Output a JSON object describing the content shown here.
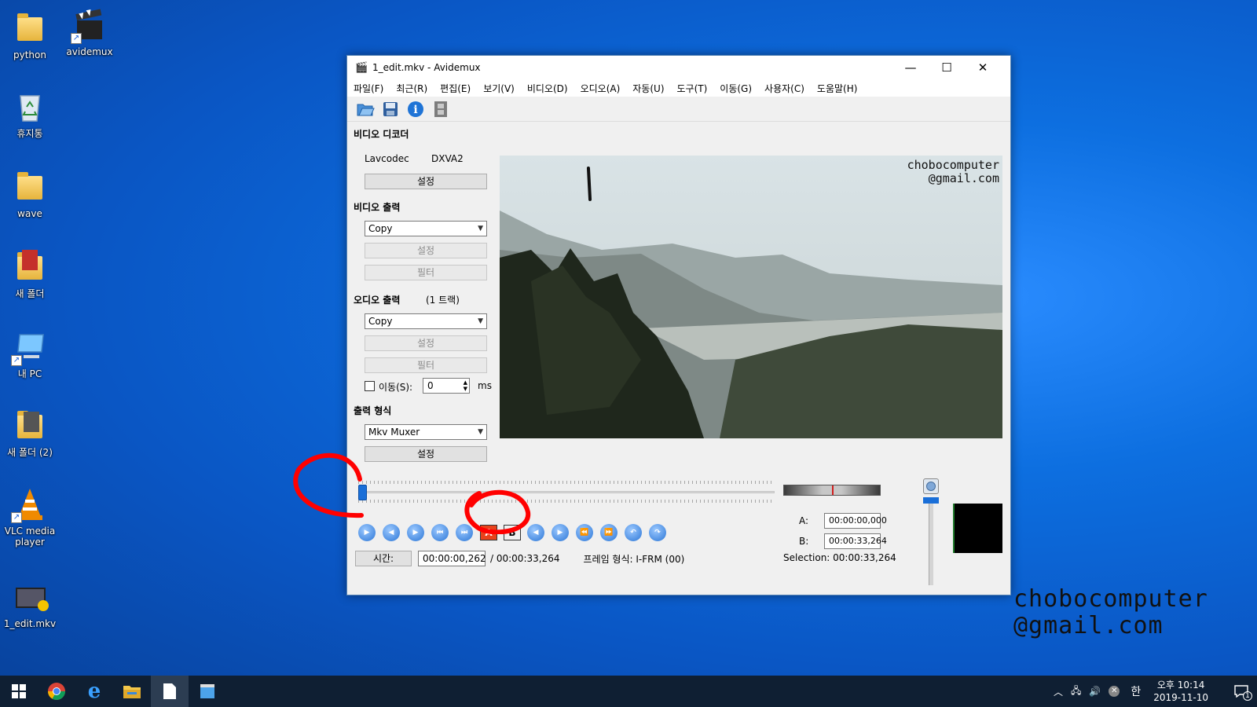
{
  "desktop": {
    "icons": [
      {
        "label": "python"
      },
      {
        "label": "avidemux"
      },
      {
        "label": "휴지통"
      },
      {
        "label": "wave"
      },
      {
        "label": "새 폴더"
      },
      {
        "label": "내 PC"
      },
      {
        "label": "새 폴더 (2)"
      },
      {
        "label": "VLC media player"
      },
      {
        "label": "1_edit.mkv"
      }
    ],
    "watermark": "chobocomputer\n@gmail.com"
  },
  "window": {
    "title": "1_edit.mkv - Avidemux",
    "controls": {
      "minimize": "—",
      "maximize": "☐",
      "close": "✕"
    },
    "menu": [
      "파일(F)",
      "최근(R)",
      "편집(E)",
      "보기(V)",
      "비디오(D)",
      "오디오(A)",
      "자동(U)",
      "도구(T)",
      "이동(G)",
      "사용자(C)",
      "도움말(H)"
    ],
    "toolbar": [
      "open-icon",
      "save-icon",
      "info-icon",
      "filmstrip-icon"
    ],
    "video_decoder": {
      "title": "비디오 디코더",
      "codec": "Lavcodec",
      "accel": "DXVA2",
      "settings_button": "설정"
    },
    "video_output": {
      "title": "비디오 출력",
      "codec": "Copy",
      "settings_button": "설정",
      "filter_button": "필터"
    },
    "audio_output": {
      "title": "오디오 출력",
      "tracks": "(1 트랙)",
      "codec": "Copy",
      "settings_button": "설정",
      "filter_button": "필터",
      "shift_label": "이동(S):",
      "shift_value": "0",
      "shift_unit": "ms"
    },
    "output_format": {
      "title": "출력 형식",
      "muxer": "Mkv Muxer",
      "settings_button": "설정"
    },
    "video_watermark": "chobocomputer\n@gmail.com",
    "playback": {
      "position_fraction": 0.0,
      "markers": {
        "a_label": "A",
        "b_label": "B"
      }
    },
    "time": {
      "button": "시간:",
      "current": "00:00:00,262",
      "total": "/ 00:00:33,264",
      "frame_type": "프레임 형식: I-FRM (00)"
    },
    "selection": {
      "a_label": "A:",
      "a_value": "00:00:00,000",
      "b_label": "B:",
      "b_value": "00:00:33,264",
      "selection_text": "Selection: 00:00:33,264"
    }
  },
  "taskbar": {
    "apps": [
      "windows-start-icon",
      "chrome-icon",
      "edge-icon",
      "file-explorer-icon",
      "notepad-icon",
      "avidemux-icon"
    ],
    "tray": {
      "ime": "한",
      "ampm": "오후 10:14",
      "date": "2019-11-10",
      "notification_count": "1"
    }
  }
}
